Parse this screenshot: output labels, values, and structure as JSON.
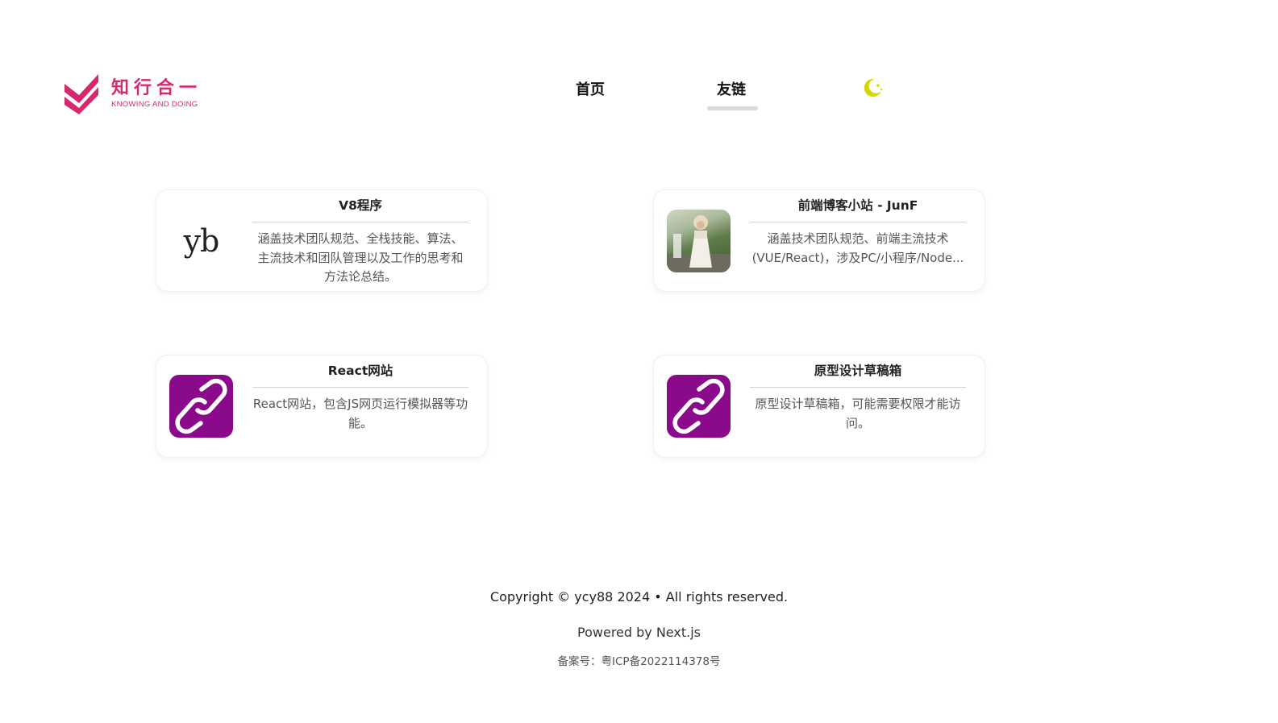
{
  "header": {
    "logo": {
      "title_cn": "知行合一",
      "subtitle_en": "KNOWING AND DOING",
      "brand_color": "#d6286f"
    },
    "nav": [
      {
        "label": "首页",
        "active": false
      },
      {
        "label": "友链",
        "active": true
      }
    ],
    "theme_toggle_icon": "moon-star-icon",
    "theme_toggle_color": "#d4d800"
  },
  "friend_links": [
    {
      "thumb_type": "text",
      "thumb_text": "yb",
      "title": "V8程序",
      "description": "涵盖技术团队规范、全栈技能、算法、主流技术和团队管理以及工作的思考和方法论总结。"
    },
    {
      "thumb_type": "photo",
      "title": "前端博客小站 - JunF",
      "description": "涵盖技术团队规范、前端主流技术(VUE/React)，涉及PC/小程序/Node..."
    },
    {
      "thumb_type": "link-icon",
      "thumb_color": "#8b0a8c",
      "title": "React网站",
      "description": "React网站，包含JS网页运行模拟器等功能。"
    },
    {
      "thumb_type": "link-icon",
      "thumb_color": "#8b0a8c",
      "title": "原型设计草稿箱",
      "description": "原型设计草稿箱，可能需要权限才能访问。"
    }
  ],
  "footer": {
    "copyright": "Copyright © ycy88 2024 • All rights reserved.",
    "powered_by": "Powered by Next.js",
    "icp": "备案号：粤ICP备2022114378号"
  }
}
